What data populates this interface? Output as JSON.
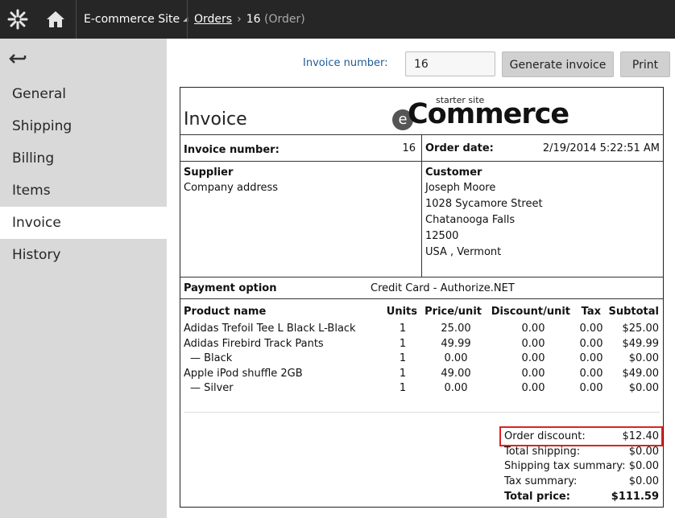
{
  "topbar": {
    "site_name": "E-commerce Site",
    "crumb_orders": "Orders",
    "crumb_current": "16",
    "crumb_type": "(Order)"
  },
  "icons": {
    "logo": "kentico-logo-icon",
    "home": "home-icon",
    "back": "back-arrow-icon"
  },
  "sidebar": {
    "items": [
      {
        "label": "General"
      },
      {
        "label": "Shipping"
      },
      {
        "label": "Billing"
      },
      {
        "label": "Items"
      },
      {
        "label": "Invoice",
        "active": true
      },
      {
        "label": "History"
      }
    ]
  },
  "toolbar": {
    "invoice_number_label": "Invoice number:",
    "invoice_number_value": "16",
    "generate_label": "Generate invoice",
    "print_label": "Print"
  },
  "invoice": {
    "title": "Invoice",
    "brand_small": "starter site",
    "brand_e": "e",
    "brand_word": "Commerce",
    "number_label": "Invoice number:",
    "number_value": "16",
    "date_label": "Order date:",
    "date_value": "2/19/2014 5:22:51 AM",
    "supplier_label": "Supplier",
    "supplier_address": "Company address",
    "customer_label": "Customer",
    "customer_lines": [
      "Joseph Moore",
      "1028 Sycamore Street",
      "Chatanooga Falls",
      "12500",
      "USA , Vermont"
    ],
    "payment_label": "Payment option",
    "payment_value": "Credit Card - Authorize.NET",
    "columns": [
      "Product name",
      "Units",
      "Price/unit",
      "Discount/unit",
      "Tax",
      "Subtotal"
    ],
    "rows": [
      [
        "Adidas Trefoil Tee L Black L-Black",
        "1",
        "25.00",
        "0.00",
        "0.00",
        "$25.00"
      ],
      [
        "Adidas Firebird Track Pants",
        "1",
        "49.99",
        "0.00",
        "0.00",
        "$49.99"
      ],
      [
        "— Black",
        "1",
        "0.00",
        "0.00",
        "0.00",
        "$0.00"
      ],
      [
        "Apple iPod shuffle 2GB",
        "1",
        "49.00",
        "0.00",
        "0.00",
        "$49.00"
      ],
      [
        "— Silver",
        "1",
        "0.00",
        "0.00",
        "0.00",
        "$0.00"
      ]
    ],
    "summary": [
      [
        "Order discount:",
        "$12.40"
      ],
      [
        "Total shipping:",
        "$0.00"
      ],
      [
        "Shipping tax summary:",
        "$0.00"
      ],
      [
        "Tax summary:",
        "$0.00"
      ],
      [
        "Total price:",
        "$111.59"
      ]
    ]
  },
  "colors": {
    "topbar": "#262626",
    "sidebar": "#d9d9d9",
    "label_blue": "#1f5b99",
    "highlight": "#dd2222"
  }
}
